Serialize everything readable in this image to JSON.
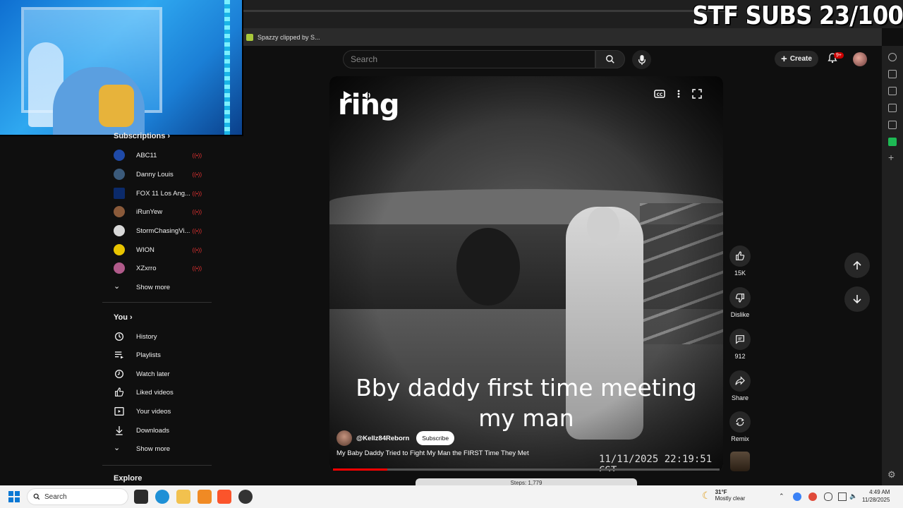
{
  "overlay": {
    "stream_text": "STF SUBS 23/100"
  },
  "tab": {
    "title": "Spazzy clipped by S..."
  },
  "header": {
    "search_placeholder": "Search",
    "create_label": "Create",
    "notifications_badge": "9+"
  },
  "sidebar": {
    "subscriptions_heading": "Subscriptions",
    "subscriptions": [
      {
        "label": "ABC11",
        "color": "#1f4aa8"
      },
      {
        "label": "Danny Louis",
        "color": "#3b5a7a"
      },
      {
        "label": "FOX 11 Los Ang...",
        "color": "#0b2a6a"
      },
      {
        "label": "iRunYew",
        "color": "#8a5a3a"
      },
      {
        "label": "StormChasingVi...",
        "color": "#d8d8d8"
      },
      {
        "label": "WION",
        "color": "#e8c400"
      },
      {
        "label": "XZxrro",
        "color": "#b05a8a"
      }
    ],
    "show_more": "Show more",
    "you_heading": "You",
    "you_items": [
      {
        "label": "History",
        "icon": "history-icon"
      },
      {
        "label": "Playlists",
        "icon": "playlists-icon"
      },
      {
        "label": "Watch later",
        "icon": "watch-later-icon"
      },
      {
        "label": "Liked videos",
        "icon": "thumbs-up-icon"
      },
      {
        "label": "Your videos",
        "icon": "your-videos-icon"
      },
      {
        "label": "Downloads",
        "icon": "download-icon"
      }
    ],
    "show_more_2": "Show more",
    "explore_heading": "Explore"
  },
  "video": {
    "brand": "ring",
    "caption_line1": "Bby daddy first time meeting",
    "caption_line2": "my man",
    "timestamp": "11/11/2025 22:19:51 CST",
    "channel": "@Kellz84Reborn",
    "subscribe_label": "Subscribe",
    "title": "My Baby Daddy Tried to Fight My Man the FIRST Time They Met",
    "progress": 0.14
  },
  "actions": {
    "like_count": "15K",
    "dislike_label": "Dislike",
    "comment_count": "912",
    "share_label": "Share",
    "remix_label": "Remix"
  },
  "next_short": {
    "peek_text": "Steps: 1,779"
  },
  "taskbar": {
    "search_label": "Search",
    "weather_temp": "31°F",
    "weather_desc": "Mostly clear",
    "time": "4:49 AM",
    "date": "11/28/2025"
  }
}
